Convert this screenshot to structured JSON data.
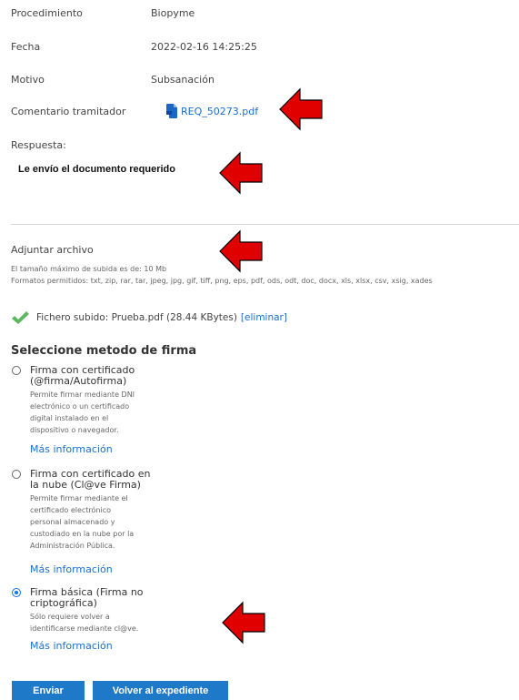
{
  "details": {
    "procedimiento_label": "Procedimiento",
    "procedimiento_value": "Biopyme",
    "fecha_label": "Fecha",
    "fecha_value": "2022-02-16 14:25:25",
    "motivo_label": "Motivo",
    "motivo_value": "Subsanación",
    "comentario_label": "Comentario tramitador",
    "comentario_file": "REQ_50273.pdf"
  },
  "respuesta": {
    "label": "Respuesta:",
    "text": "Le envío el documento requerido"
  },
  "adjuntar": {
    "title": "Adjuntar archivo",
    "max_size": "El tamaño máximo de subida es de: 10 Mb",
    "formats": "Formatos permitidos: txt, zip, rar, tar, jpeg, jpg, gif, tiff, png, eps, pdf, ods, odt, doc, docx, xls, xlsx, csv, xsig, xades"
  },
  "uploaded": {
    "text": "Fichero subido: Prueba.pdf (28.44 KBytes)",
    "delete_label": "[eliminar]"
  },
  "firma": {
    "title": "Seleccione metodo de firma",
    "selected_index": 2,
    "options": [
      {
        "title_lines": [
          "Firma con certificado",
          "(@firma/Autofirma)"
        ],
        "desc_lines": [
          "Permite firmar mediante DNI",
          "electrónico o un certificado",
          "digital instalado en el",
          "dispositivo o navegador."
        ],
        "more": "Más información"
      },
      {
        "title_lines": [
          "Firma con certificado en",
          "la nube (Cl@ve Firma)"
        ],
        "desc_lines": [
          "Permite firmar mediante el",
          "certificado electrónico",
          "personal almacenado y",
          "custodiado en la nube por la",
          "Administración Pública."
        ],
        "more": "Más información"
      },
      {
        "title_lines": [
          "Firma básica (Firma no",
          "criptográfica)"
        ],
        "desc_lines": [
          "Sólo requiere volver a",
          "identificarse mediante cl@ve."
        ],
        "more": "Más información"
      }
    ]
  },
  "buttons": {
    "enviar": "Enviar",
    "volver": "Volver al expediente"
  },
  "colors": {
    "accent": "#1f79c9",
    "link": "#1a6fd1",
    "arrow": "#e00000",
    "check": "#5cb85c"
  },
  "icons": {
    "file": "pdf-file-icon",
    "uploaded": "checkmark-icon",
    "annotation": "red-arrow-icon"
  }
}
